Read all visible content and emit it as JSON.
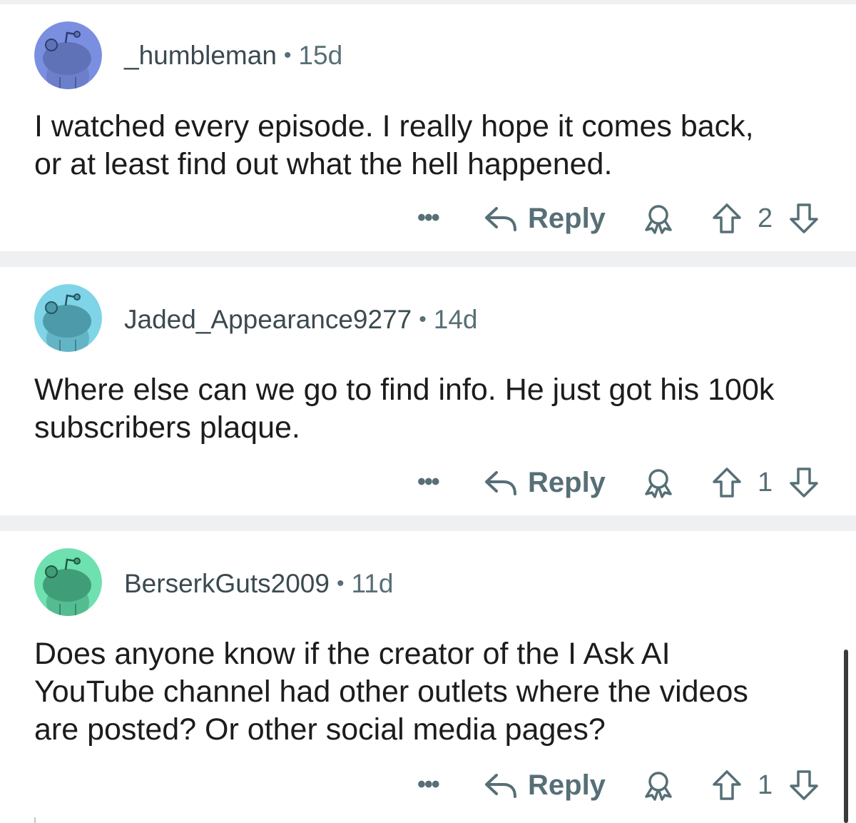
{
  "comments": [
    {
      "username": "_humbleman",
      "separator": "•",
      "age": "15d",
      "avatar_color": "#7b8fe0",
      "avatar_body": "#5f72b8",
      "text_line1": "I watched every episode. I really hope it comes back,",
      "text_line2": "or at least find out what the hell happened.",
      "more_label": "•••",
      "reply_label": "Reply",
      "score": "2"
    },
    {
      "username": "Jaded_Appearance9277",
      "separator": "•",
      "age": "14d",
      "avatar_color": "#7fd4e8",
      "avatar_body": "#4c9aaa",
      "text_line1": "Where else can we go to find info. He just got his 100k",
      "text_line2": "subscribers plaque.",
      "more_label": "•••",
      "reply_label": "Reply",
      "score": "1"
    },
    {
      "username": "BerserkGuts2009",
      "separator": "•",
      "age": "11d",
      "avatar_color": "#6fe0b0",
      "avatar_body": "#3f9e78",
      "text_line1": "Does anyone know if the creator of the I Ask AI",
      "text_line2": "YouTube channel had other outlets where the videos",
      "text_line3": "are posted?  Or other social media pages?",
      "more_label": "•••",
      "reply_label": "Reply",
      "score": "1"
    }
  ],
  "icons": {
    "reply": "reply-arrow-icon",
    "award": "award-icon",
    "upvote": "upvote-arrow-icon",
    "downvote": "downvote-arrow-icon",
    "more": "more-options-icon",
    "avatar": "snoo-avatar-icon"
  },
  "colors": {
    "meta_text": "#576f76",
    "body_text": "#1c1c1c",
    "divider": "#eef0f2"
  }
}
